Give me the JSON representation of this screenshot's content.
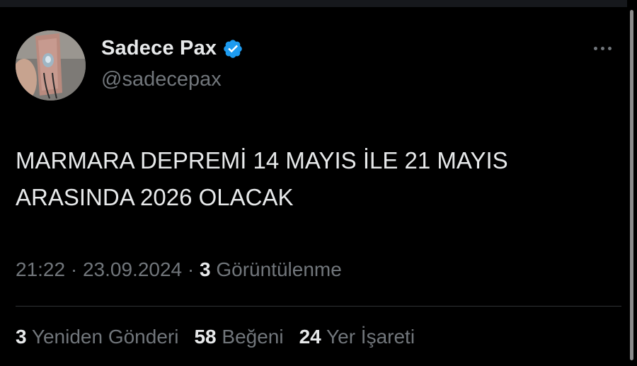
{
  "author": {
    "display_name": "Sadece Pax",
    "handle": "@sadecepax",
    "verified": true,
    "avatar_icon": "avatar-photo",
    "verified_icon": "verified-badge-icon",
    "verified_color": "#1d9bf0"
  },
  "more_icon": "more-options-icon",
  "tweet": {
    "text": "MARMARA DEPREMİ 14 MAYIS İLE 21 MAYIS\nARASINDA 2026 OLACAK"
  },
  "meta": {
    "time": "21:22",
    "separator": "·",
    "date": "23.09.2024",
    "views_count": "3",
    "views_label": "Görüntülenme"
  },
  "stats": {
    "reposts_count": "3",
    "reposts_label": "Yeniden Gönderi",
    "likes_count": "58",
    "likes_label": "Beğeni",
    "bookmarks_count": "24",
    "bookmarks_label": "Yer İşareti"
  },
  "colors": {
    "background": "#000000",
    "text_primary": "#e7e9ea",
    "text_secondary": "#71767b",
    "divider": "#2f3336"
  }
}
